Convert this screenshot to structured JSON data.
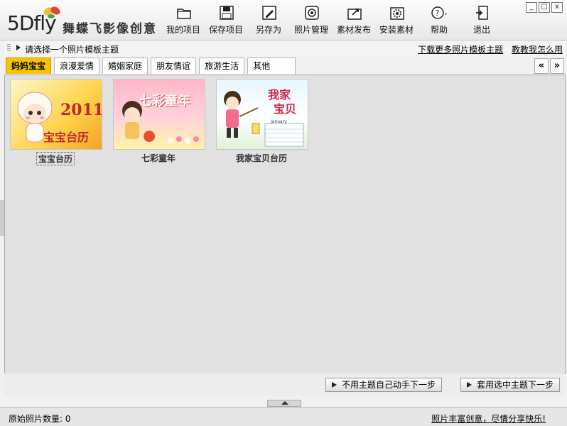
{
  "app": {
    "logo_text": "5Dfly",
    "logo_sub": "舞蝶飞影像创意"
  },
  "toolbar": [
    {
      "label": "我的项目",
      "icon": "folder-icon"
    },
    {
      "label": "保存项目",
      "icon": "save-icon"
    },
    {
      "label": "另存为",
      "icon": "save-as-icon"
    },
    {
      "label": "照片管理",
      "icon": "photo-manager-icon"
    },
    {
      "label": "素材发布",
      "icon": "publish-icon"
    },
    {
      "label": "安装素材",
      "icon": "install-icon"
    },
    {
      "label": "帮助",
      "icon": "help-icon"
    },
    {
      "label": "退出",
      "icon": "exit-icon"
    }
  ],
  "window_buttons": {
    "min": "_",
    "max": "□",
    "close": "x"
  },
  "hint": {
    "text": "请选择一个照片模板主题",
    "link_download": "下载更多照片模板主题",
    "link_help": "教教我怎么用"
  },
  "tabs": [
    {
      "label": "妈妈宝宝",
      "active": true
    },
    {
      "label": "浪漫爱情",
      "active": false
    },
    {
      "label": "婚姻家庭",
      "active": false
    },
    {
      "label": "朋友情谊",
      "active": false
    },
    {
      "label": "旅游生活",
      "active": false
    },
    {
      "label": "其他",
      "active": false
    }
  ],
  "tab_nav": {
    "prev": "«",
    "next": "»"
  },
  "templates": [
    {
      "caption": "宝宝台历",
      "selected": true,
      "art_year": "2011",
      "art_title": "宝宝台历"
    },
    {
      "caption": "七彩童年",
      "selected": false,
      "art_title": "七彩童年"
    },
    {
      "caption": "我家宝贝台历",
      "selected": false,
      "art_title_1": "我家",
      "art_title_2": "宝贝",
      "art_month": "January"
    }
  ],
  "actions": {
    "no_theme": "不用主题自己动手下一步",
    "use_theme": "套用选中主题下一步"
  },
  "status": {
    "left": "原始照片数量: 0",
    "right": "照片丰富创意，尽情分享快乐!"
  },
  "colors": {
    "tab_active": "#f7c400",
    "content_bg": "#e1e1e1"
  }
}
